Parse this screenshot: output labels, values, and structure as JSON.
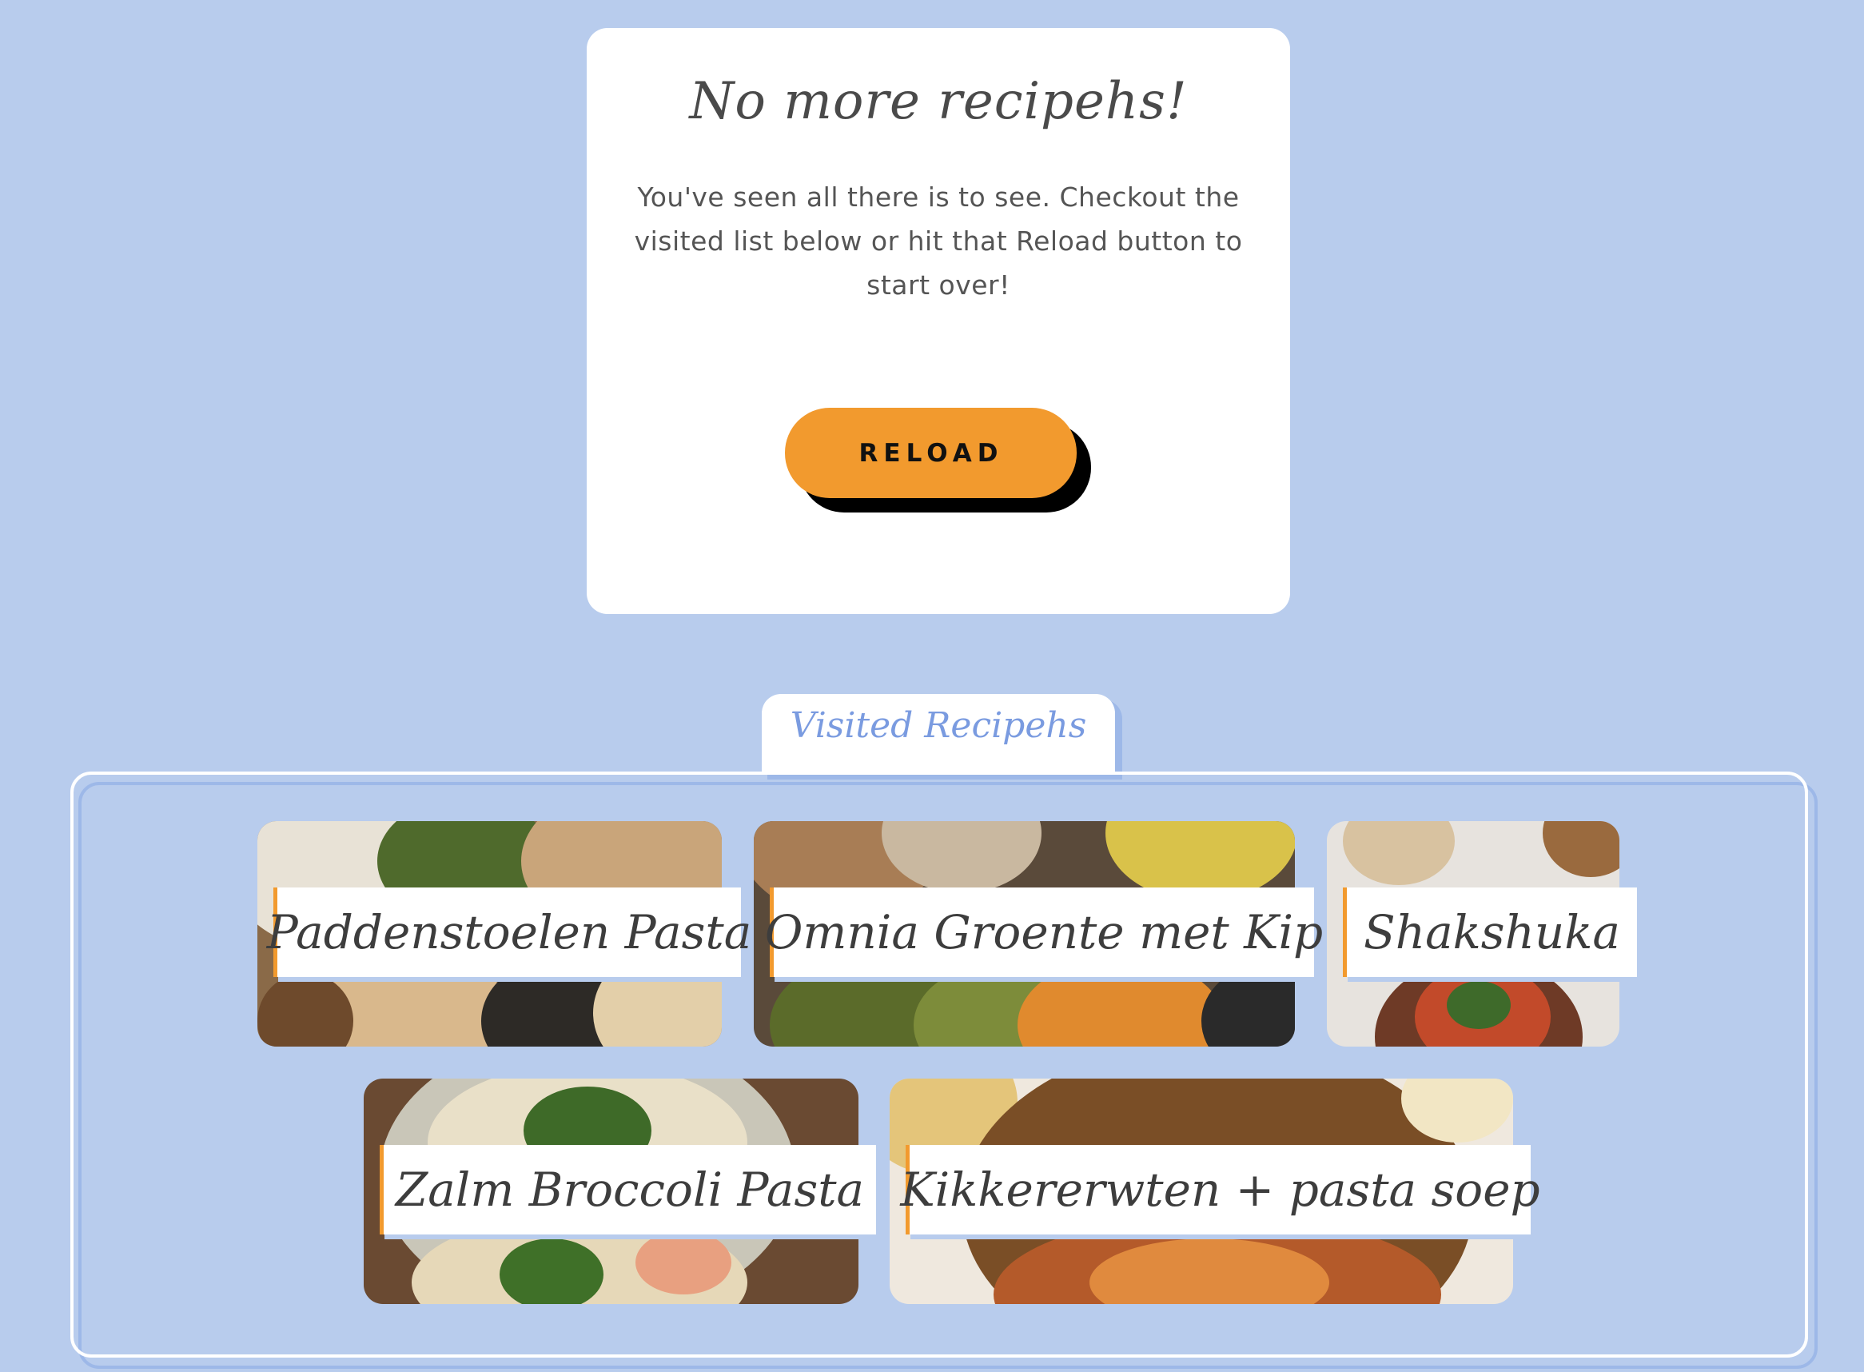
{
  "card": {
    "title": "No more recipehs!",
    "text": "You've seen all there is to see. Checkout the visited list below or hit that Reload button to start over!",
    "reload_label": "RELOAD"
  },
  "visited": {
    "tab_label": "Visited Recipehs",
    "recipes": [
      {
        "label": "Paddenstoelen Pasta"
      },
      {
        "label": "Omnia Groente met Kip"
      },
      {
        "label": "Shakshuka"
      },
      {
        "label": "Zalm Broccoli Pasta"
      },
      {
        "label": "Kikkererwten + pasta soep"
      }
    ]
  },
  "colors": {
    "background": "#b8cced",
    "accent": "#f29a2e",
    "tab_text": "#7a9be0"
  }
}
